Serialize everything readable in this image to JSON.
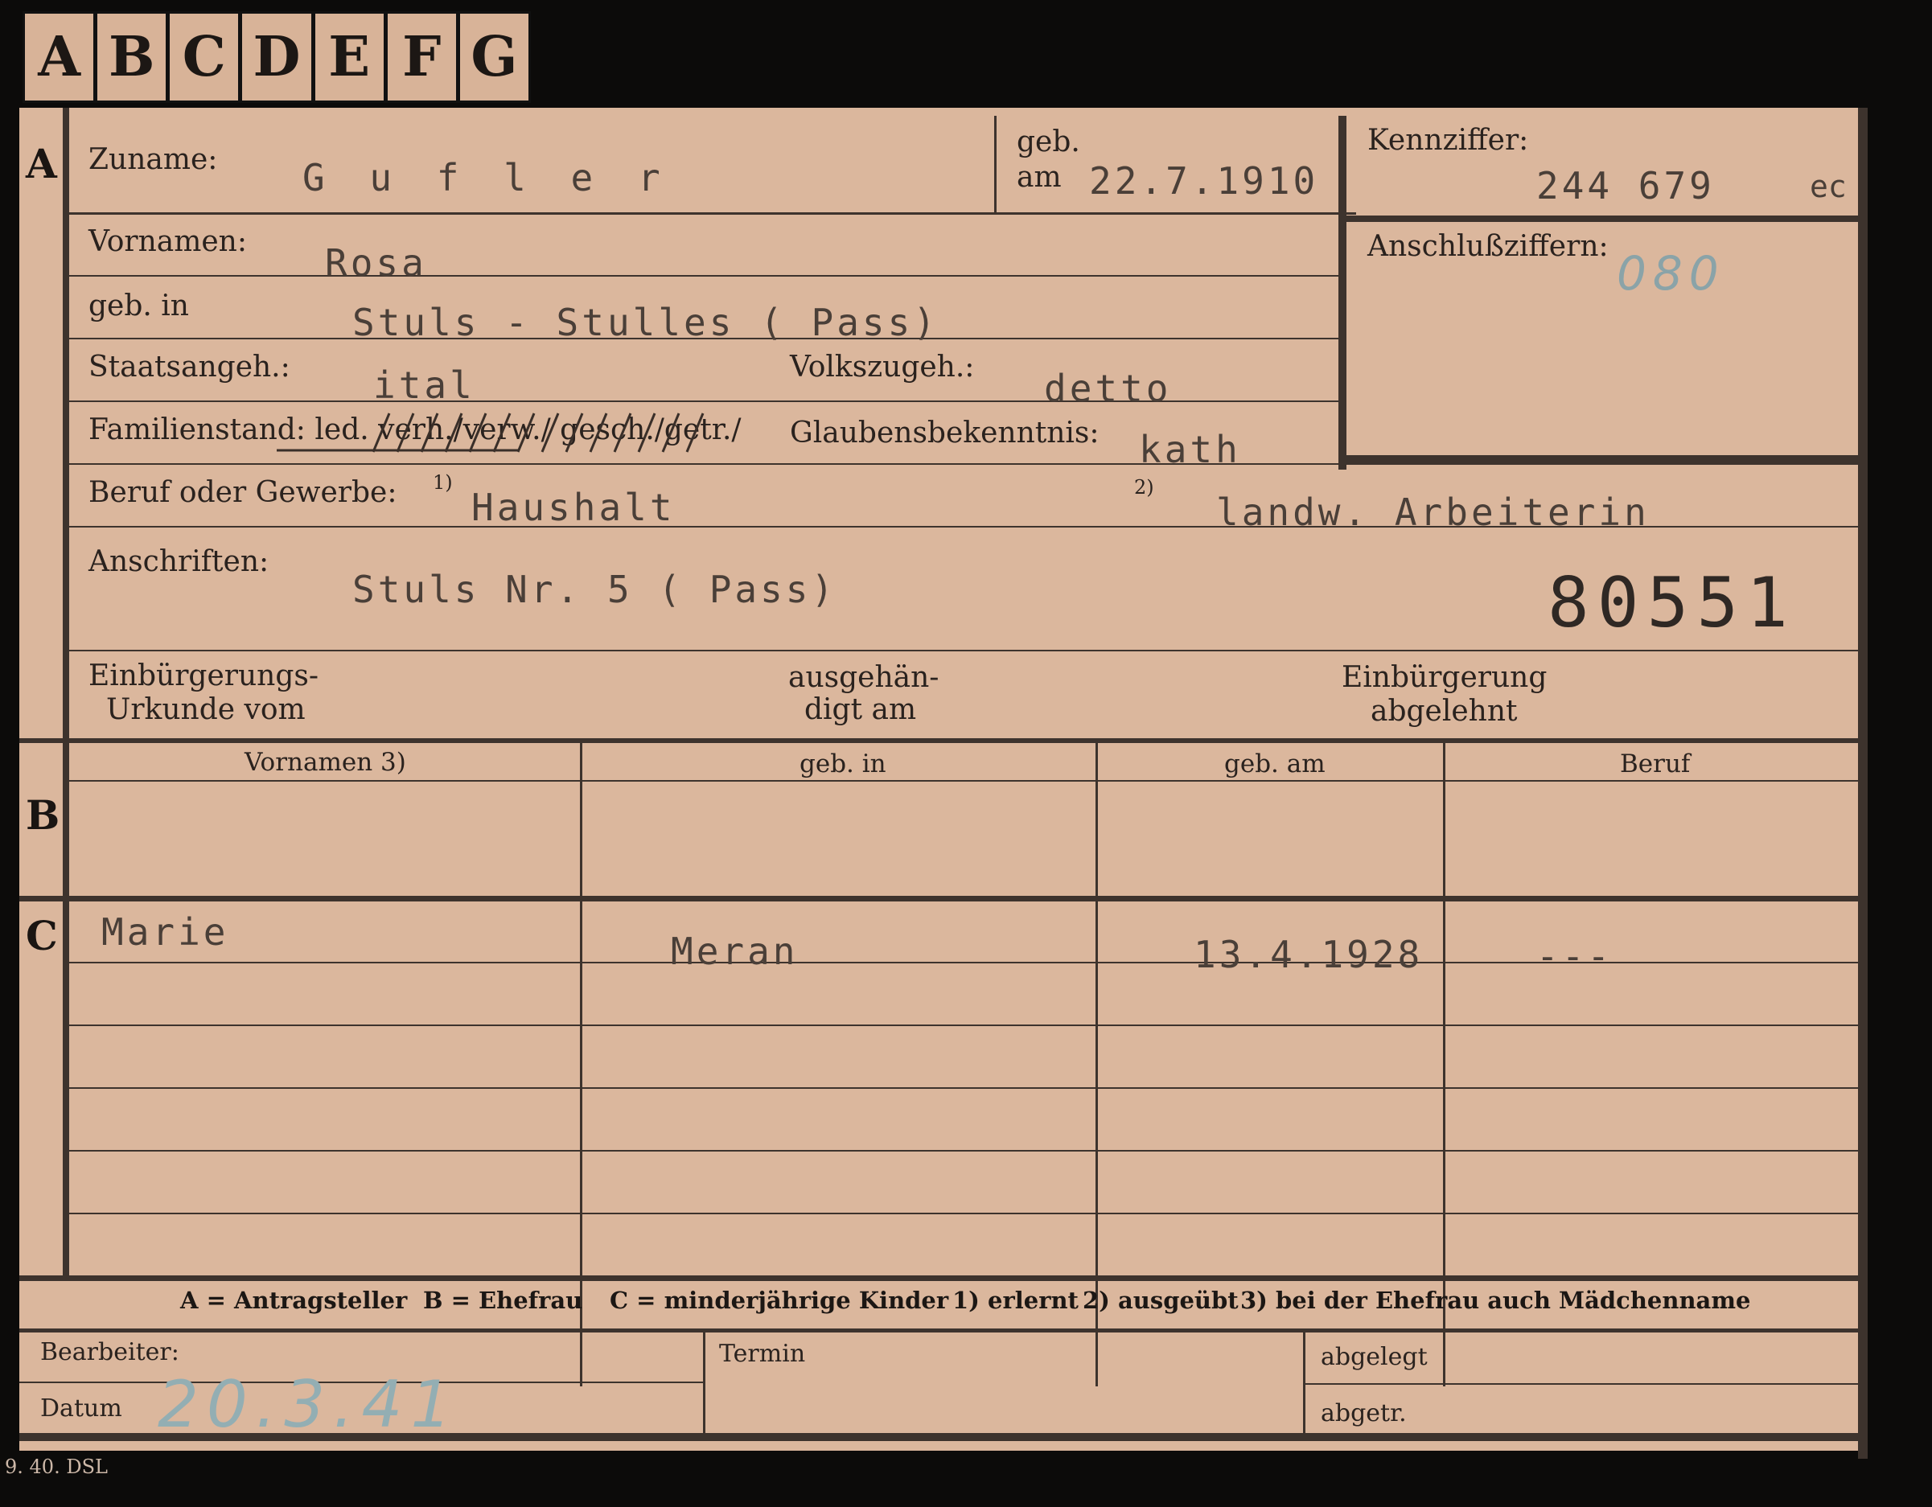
{
  "tabs": [
    "A",
    "B",
    "C",
    "D",
    "E",
    "F",
    "G"
  ],
  "sections": {
    "a": "A",
    "b": "B",
    "c": "C"
  },
  "applicant": {
    "surname_label": "Zuname:",
    "surname": "G u f l e r",
    "born_label_1": "geb.",
    "born_label_2": "am",
    "born_date": "22.7.1910",
    "id_label": "Kennziffer:",
    "id_number": "244 679",
    "id_suffix": "ec",
    "followup_label": "Anschlußziffern:",
    "followup_value": "080",
    "firstname_label": "Vornamen:",
    "firstname": "Rosa",
    "birthplace_label": "geb. in",
    "birthplace": "Stuls - Stulles ( Pass)",
    "citizenship_label": "Staatsangeh.:",
    "citizenship": "ital",
    "ethnicity_label": "Volkszugeh.:",
    "ethnicity": "detto",
    "marital_label": "Familienstand: led. verh./verw./ gesch./getr./",
    "religion_label": "Glaubensbekenntnis:",
    "religion": "kath",
    "occupation_label": "Beruf oder Gewerbe:",
    "occ_mark_1": "1)",
    "occupation_learned": "Haushalt",
    "occ_mark_2": "2)",
    "occupation_practiced": "landw. Arbeiterin",
    "address_label": "Anschriften:",
    "address": "Stuls Nr. 5 ( Pass)",
    "file_number": "80551",
    "naturalization_label_1": "Einbürgerungs-",
    "naturalization_label_2": "Urkunde vom",
    "issued_label_1": "ausgehän-",
    "issued_label_2": "digt am",
    "rejected_label_1": "Einbürgerung",
    "rejected_label_2": "abgelehnt"
  },
  "table": {
    "headers": [
      "Vornamen 3)",
      "geb. in",
      "geb. am",
      "Beruf"
    ],
    "children": [
      {
        "name": "Marie",
        "place": "Meran",
        "date": "13.4.1928",
        "occupation": "---"
      }
    ]
  },
  "legend": {
    "a": "A = Antragsteller",
    "b": "B = Ehefrau",
    "c": "C = minderjährige Kinder",
    "n1": "1) erlernt",
    "n2": "2) ausgeübt",
    "n3": "3) bei der Ehefrau auch Mädchenname"
  },
  "footer": {
    "clerk_label": "Bearbeiter:",
    "date_label": "Datum",
    "date_value": "20.3.41",
    "appointment_label": "Termin",
    "filed_label": "abgelegt",
    "transferred_label": "abgetr.",
    "print_code": "9. 40. DSL"
  },
  "colors": {
    "card": "#dbb79d",
    "ink": "#2b2420",
    "frame": "#0c0b0a",
    "pencil": "#8aa3a8"
  }
}
